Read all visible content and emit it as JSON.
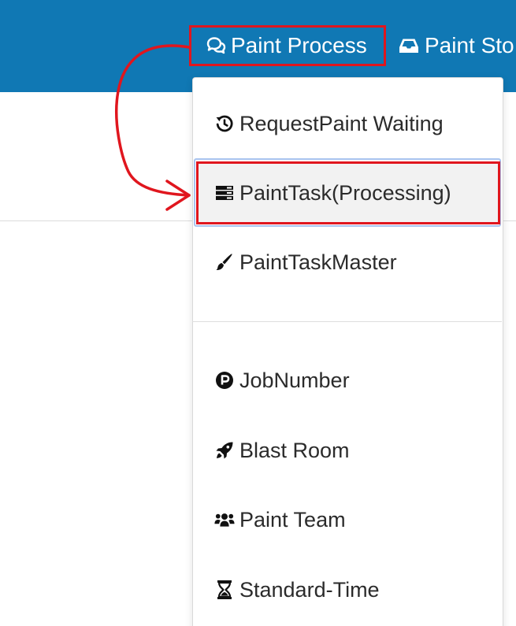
{
  "navbar": {
    "paint_process_label": "Paint Process",
    "paint_stock_label": "Paint Sto",
    "background": "#1078b4",
    "highlight_color": "#e0161e"
  },
  "dropdown": {
    "items": [
      {
        "label": "RequestPaint Waiting",
        "icon": "history-icon"
      },
      {
        "label": "PaintTask(Processing)",
        "icon": "server-icon"
      },
      {
        "label": "PaintTaskMaster",
        "icon": "paint-brush-icon"
      },
      {
        "label": "JobNumber",
        "icon": "parking-icon"
      },
      {
        "label": "Blast Room",
        "icon": "rocket-icon"
      },
      {
        "label": "Paint Team",
        "icon": "users-icon"
      },
      {
        "label": "Standard-Time",
        "icon": "hourglass-icon"
      }
    ],
    "active_item": "PaintTask(Processing)"
  }
}
